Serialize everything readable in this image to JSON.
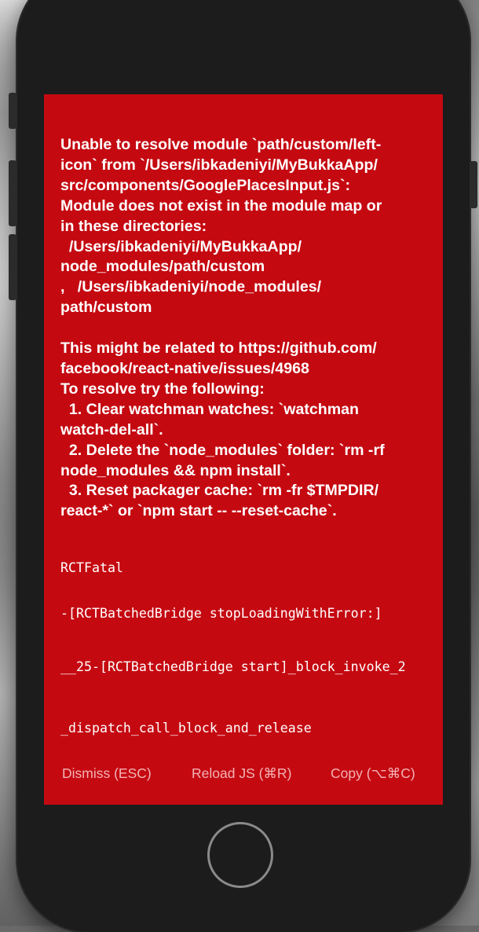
{
  "error": {
    "message": "Unable to resolve module `path/custom/left-\nicon` from `/Users/ibkadeniyi/MyBukkaApp/\nsrc/components/GooglePlacesInput.js`:\nModule does not exist in the module map or\nin these directories:\n  /Users/ibkadeniyi/MyBukkaApp/\nnode_modules/path/custom\n,   /Users/ibkadeniyi/node_modules/\npath/custom\n\nThis might be related to https://github.com/\nfacebook/react-native/issues/4968\nTo resolve try the following:\n  1. Clear watchman watches: `watchman\nwatch-del-all`.\n  2. Delete the `node_modules` folder: `rm -rf\nnode_modules && npm install`.\n  3. Reset packager cache: `rm -fr $TMPDIR/\nreact-*` or `npm start -- --reset-cache`.",
    "stack": [
      "RCTFatal",
      "-[RCTBatchedBridge stopLoadingWithError:]",
      "__25-[RCTBatchedBridge start]_block_invoke_2",
      "_dispatch_call_block_and_release"
    ]
  },
  "actions": {
    "dismiss_label": "Dismiss (ESC)",
    "reload_label": "Reload JS (⌘R)",
    "copy_label": "Copy (⌥⌘C)"
  },
  "colors": {
    "error_background": "#c50911",
    "action_text": "#f2b3b6"
  }
}
